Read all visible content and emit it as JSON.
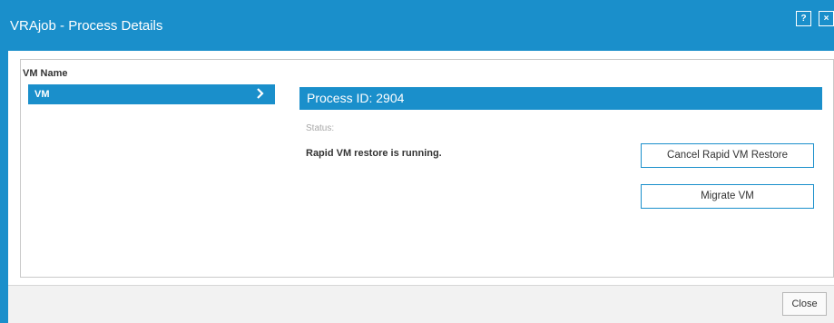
{
  "window": {
    "title": "VRAjob - Process Details",
    "help_label": "?",
    "close_label": "×"
  },
  "left_panel": {
    "header": "VM Name",
    "items": [
      {
        "label": "VM",
        "selected": true
      }
    ]
  },
  "process": {
    "header": "Process ID: 2904",
    "status_label": "Status:",
    "status_value": "Rapid VM restore is running."
  },
  "actions": {
    "cancel_label": "Cancel Rapid VM Restore",
    "migrate_label": "Migrate VM"
  },
  "footer": {
    "close_label": "Close"
  },
  "colors": {
    "accent": "#1a8fcb",
    "border": "#c9c9c9",
    "muted_text": "#a7a7a7"
  }
}
